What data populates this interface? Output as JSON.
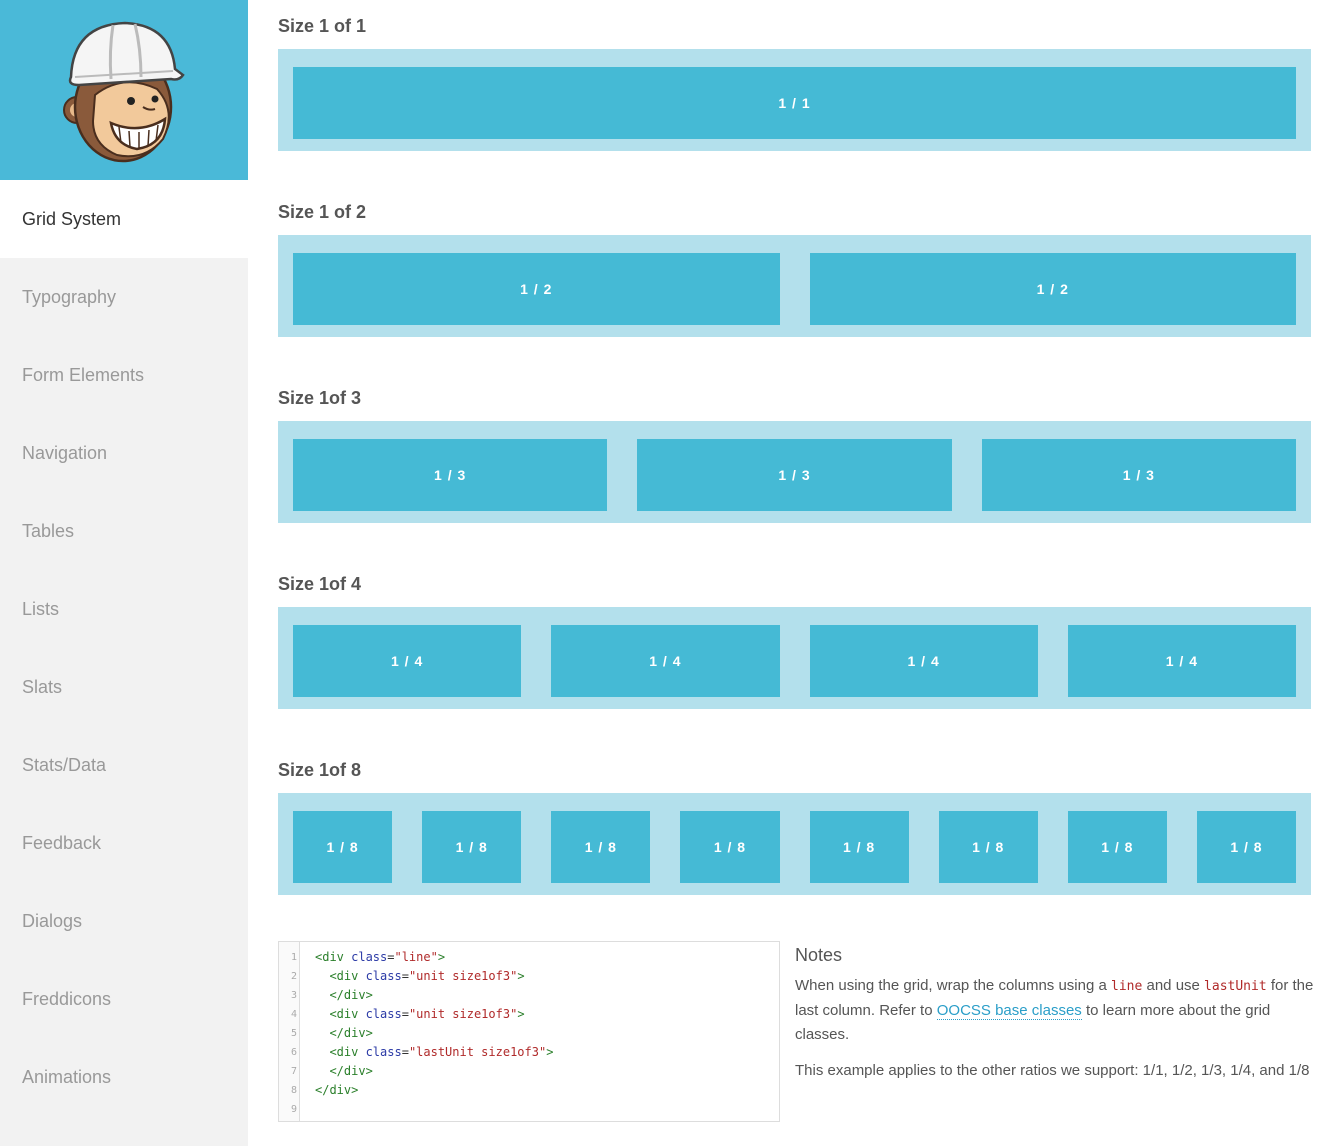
{
  "sidebar": {
    "items": [
      {
        "label": "Grid System",
        "active": true
      },
      {
        "label": "Typography"
      },
      {
        "label": "Form Elements"
      },
      {
        "label": "Navigation"
      },
      {
        "label": "Tables"
      },
      {
        "label": "Lists"
      },
      {
        "label": "Slats"
      },
      {
        "label": "Stats/Data"
      },
      {
        "label": "Feedback"
      },
      {
        "label": "Dialogs"
      },
      {
        "label": "Freddicons"
      },
      {
        "label": "Animations"
      }
    ]
  },
  "sections": [
    {
      "title": "Size 1 of 1",
      "unit_label": "1 / 1",
      "count": 1
    },
    {
      "title": "Size 1 of 2",
      "unit_label": "1 / 2",
      "count": 2
    },
    {
      "title": "Size 1of 3",
      "unit_label": "1 / 3",
      "count": 3
    },
    {
      "title": "Size 1of 4",
      "unit_label": "1 / 4",
      "count": 4
    },
    {
      "title": "Size 1of 8",
      "unit_label": "1 / 8",
      "count": 8
    }
  ],
  "code": {
    "line_numbers": [
      "1",
      "2",
      "3",
      "4",
      "5",
      "6",
      "7",
      "8",
      "9"
    ],
    "lines": [
      {
        "indent": "",
        "parts": [
          {
            "t": "tag",
            "v": "<div "
          },
          {
            "t": "attr",
            "v": "class"
          },
          {
            "t": "plain",
            "v": "="
          },
          {
            "t": "str",
            "v": "\"line\""
          },
          {
            "t": "tag",
            "v": ">"
          }
        ]
      },
      {
        "indent": "  ",
        "parts": [
          {
            "t": "tag",
            "v": "<div "
          },
          {
            "t": "attr",
            "v": "class"
          },
          {
            "t": "plain",
            "v": "="
          },
          {
            "t": "str",
            "v": "\"unit size1of3\""
          },
          {
            "t": "tag",
            "v": ">"
          }
        ]
      },
      {
        "indent": "  ",
        "parts": [
          {
            "t": "tag",
            "v": "</div>"
          }
        ]
      },
      {
        "indent": "  ",
        "parts": [
          {
            "t": "tag",
            "v": "<div "
          },
          {
            "t": "attr",
            "v": "class"
          },
          {
            "t": "plain",
            "v": "="
          },
          {
            "t": "str",
            "v": "\"unit size1of3\""
          },
          {
            "t": "tag",
            "v": ">"
          }
        ]
      },
      {
        "indent": "  ",
        "parts": [
          {
            "t": "tag",
            "v": "</div>"
          }
        ]
      },
      {
        "indent": "  ",
        "parts": [
          {
            "t": "tag",
            "v": "<div "
          },
          {
            "t": "attr",
            "v": "class"
          },
          {
            "t": "plain",
            "v": "="
          },
          {
            "t": "str",
            "v": "\"lastUnit size1of3\""
          },
          {
            "t": "tag",
            "v": ">"
          }
        ]
      },
      {
        "indent": "  ",
        "parts": [
          {
            "t": "tag",
            "v": "</div>"
          }
        ]
      },
      {
        "indent": "",
        "parts": [
          {
            "t": "tag",
            "v": "</div>"
          }
        ]
      },
      {
        "indent": "",
        "parts": []
      }
    ]
  },
  "notes": {
    "title": "Notes",
    "p1_before_line": "When using the grid, wrap the columns using a ",
    "p1_code_line": "line",
    "p1_between": " and use ",
    "p1_code_last": "lastUnit",
    "p1_after_last": " for the last column. Refer to ",
    "p1_link": "OOCSS base classes",
    "p1_end": " to learn more about the grid classes.",
    "p2": "This example applies to the other ratios we support: 1/1, 1/2, 1/3, 1/4, and 1/8"
  },
  "colors": {
    "brand": "#4ab9d8",
    "unit": "#45bad5",
    "unit_bg": "#b3e0ec",
    "sidebar_bg": "#f2f2f2"
  },
  "logo": {
    "icon": "freddie-monkey-hardhat-icon"
  }
}
